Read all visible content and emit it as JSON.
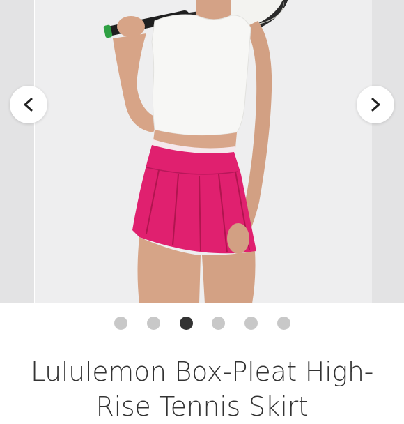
{
  "gallery": {
    "prev_icon": "chevron-left-icon",
    "next_icon": "chevron-right-icon",
    "image_count": 6,
    "active_index": 2
  },
  "product": {
    "title": "Lululemon Box-Pleat High-Rise Tennis Skirt"
  },
  "colors": {
    "skirt": "#e0206f",
    "top": "#f7f7f5",
    "active_dot": "#333333",
    "inactive_dot": "#c8c8c8"
  }
}
